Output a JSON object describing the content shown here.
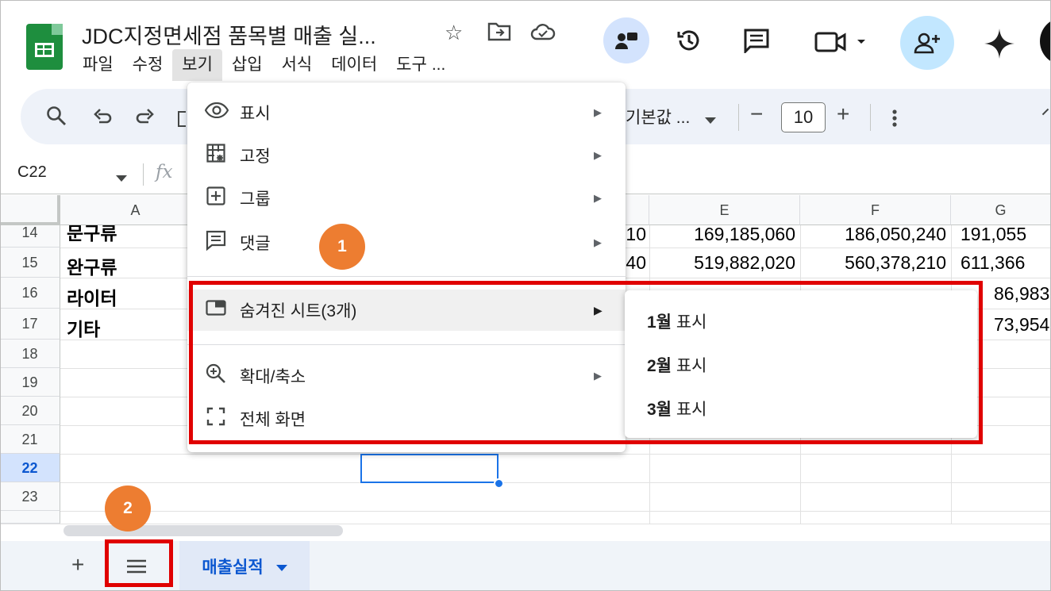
{
  "app": {
    "doc_title": "JDC지정면세점 품목별 매출 실...",
    "menus": [
      "파일",
      "수정",
      "보기",
      "삽입",
      "서식",
      "데이터",
      "도구",
      "..."
    ]
  },
  "toolbar": {
    "font_label": "기본값 ...",
    "font_size": "10",
    "minus": "−",
    "plus": "+"
  },
  "formula_bar": {
    "name_box": "C22",
    "fx": "fx"
  },
  "grid": {
    "columns": [
      "A",
      "E",
      "F",
      "G"
    ],
    "rows": [
      {
        "num": "14",
        "a": "문구류",
        "d": "10",
        "e": "169,185,060",
        "f": "186,050,240",
        "g": "191,055"
      },
      {
        "num": "15",
        "a": "완구류",
        "d": "40",
        "e": "519,882,020",
        "f": "560,378,210",
        "g": "611,366"
      },
      {
        "num": "16",
        "a": "라이터",
        "d": "",
        "e": "",
        "f": "",
        "g": "86,983"
      },
      {
        "num": "17",
        "a": "기타",
        "d": "",
        "e": "",
        "f": "",
        "g": "73,954"
      },
      {
        "num": "18"
      },
      {
        "num": "19"
      },
      {
        "num": "20"
      },
      {
        "num": "21"
      },
      {
        "num": "22"
      },
      {
        "num": "23"
      }
    ],
    "selected_row": "22"
  },
  "view_menu": {
    "items": [
      {
        "icon": "eye-icon",
        "label": "표시"
      },
      {
        "icon": "freeze-icon",
        "label": "고정"
      },
      {
        "icon": "group-icon",
        "label": "그룹"
      },
      {
        "icon": "comment-icon",
        "label": "댓글"
      },
      {
        "icon": "hidden-sheet-icon",
        "label": "숨겨진 시트(3개)"
      },
      {
        "icon": "zoom-icon",
        "label": "확대/축소"
      },
      {
        "icon": "fullscreen-icon",
        "label": "전체 화면"
      }
    ]
  },
  "hidden_sheets_submenu": [
    {
      "month": "1월",
      "action": "표시"
    },
    {
      "month": "2월",
      "action": "표시"
    },
    {
      "month": "3월",
      "action": "표시"
    }
  ],
  "sheet_tabs": {
    "active": "매출실적",
    "add": "+"
  },
  "callouts": [
    "1",
    "2"
  ],
  "colors": {
    "accent": "#0b57d0",
    "highlight": "#e00000",
    "callout": "#ed7d31",
    "sheets_green": "#1e8e3e"
  }
}
